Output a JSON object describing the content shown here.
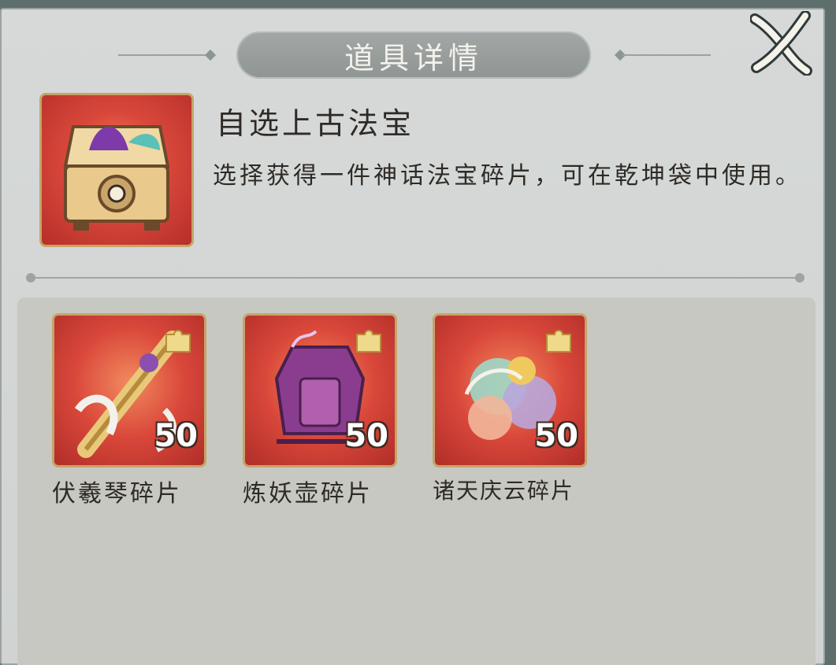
{
  "dialog": {
    "title": "道具详情"
  },
  "item": {
    "name": "自选上古法宝",
    "description": "选择获得一件神话法宝碎片，可在乾坤袋中使用。",
    "icon": "treasure-chest-icon"
  },
  "rewards": [
    {
      "label": "伏羲琴碎片",
      "count": "50",
      "icon": "fuxi-zither-icon"
    },
    {
      "label": "炼妖壶碎片",
      "count": "50",
      "icon": "demon-refining-pot-icon"
    },
    {
      "label": "诸天庆云碎片",
      "count": "50",
      "icon": "auspicious-cloud-icon"
    }
  ],
  "colors": {
    "panel": "#d3d6d4",
    "title_pill": "#9a9f9d",
    "item_frame_border": "#c6a469",
    "item_bg": "#d9473a"
  }
}
